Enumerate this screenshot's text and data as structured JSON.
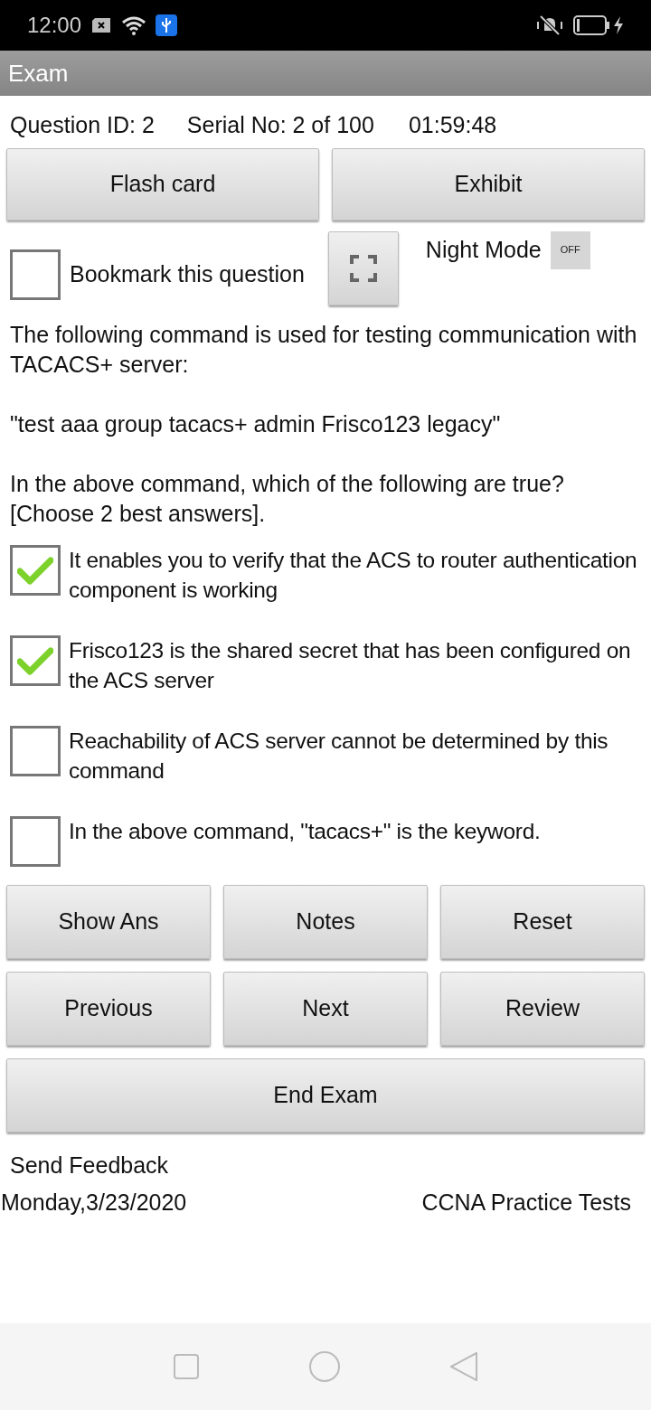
{
  "status_bar": {
    "time": "12:00"
  },
  "app_bar": {
    "title": "Exam"
  },
  "info": {
    "question_id": "Question ID: 2",
    "serial": "Serial No: 2 of 100",
    "timer": "01:59:48"
  },
  "top_buttons": [
    "Flash card",
    "Exhibit"
  ],
  "bookmark": {
    "label": "Bookmark this question",
    "checked": false
  },
  "night_mode": {
    "label": "Night Mode",
    "toggle_text": "OFF",
    "on": false
  },
  "question": [
    "The following command is used for testing communication with TACACS+ server:",
    "\"test aaa group tacacs+ admin Frisco123 legacy\"",
    "In the above command, which of the following are true? [Choose 2 best answers]."
  ],
  "options": [
    {
      "text": "It enables you to verify that the ACS to router authentication component is working",
      "checked": true
    },
    {
      "text": "Frisco123 is the shared secret that has been configured on the ACS server",
      "checked": true
    },
    {
      "text": "Reachability of ACS server cannot be determined by this command",
      "checked": false
    },
    {
      "text": "In the above command, \"tacacs+\" is the keyword.",
      "checked": false
    }
  ],
  "button_rows": [
    [
      "Show Ans",
      "Notes",
      "Reset"
    ],
    [
      "Previous",
      "Next",
      "Review"
    ]
  ],
  "end_button": "End Exam",
  "feedback_link": "Send Feedback",
  "footer": {
    "date": "Monday,3/23/2020",
    "app_name": "CCNA Practice Tests"
  }
}
